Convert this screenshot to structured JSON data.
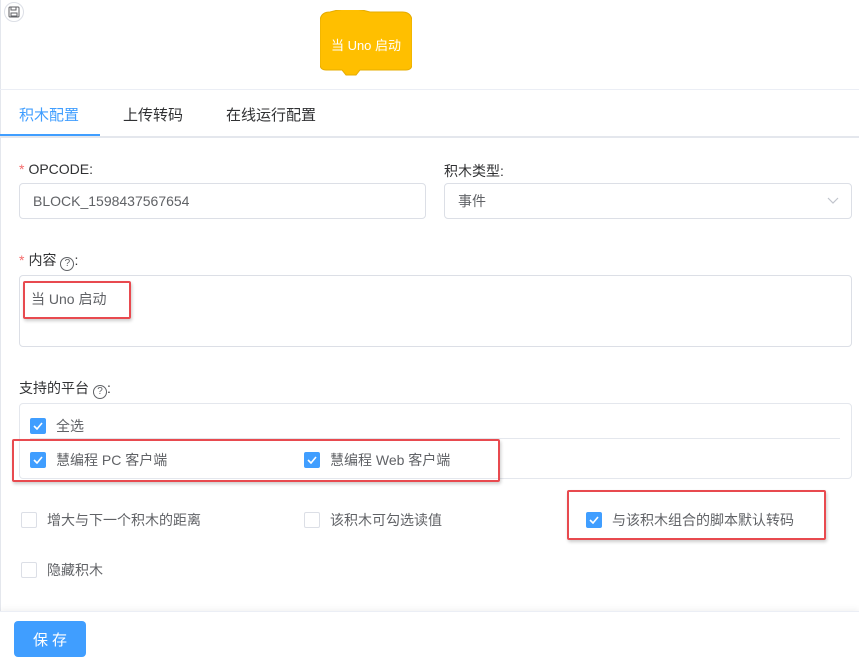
{
  "block": {
    "label": "当 Uno 启动",
    "color": "#FFBF00"
  },
  "tabs": [
    {
      "label": "积木配置",
      "active": true
    },
    {
      "label": "上传转码",
      "active": false
    },
    {
      "label": "在线运行配置",
      "active": false
    }
  ],
  "form": {
    "opcode": {
      "label": "OPCODE:",
      "required": true,
      "value": "BLOCK_1598437567654"
    },
    "block_type": {
      "label": "积木类型:",
      "value": "事件"
    },
    "content": {
      "label": "内容",
      "label_suffix": ":",
      "required": true,
      "value": "当 Uno 启动"
    },
    "platforms": {
      "label": "支持的平台",
      "label_suffix": ":",
      "select_all": {
        "label": "全选",
        "checked": true
      },
      "options": [
        {
          "label": "慧编程 PC 客户端",
          "checked": true
        },
        {
          "label": "慧编程 Web 客户端",
          "checked": true
        }
      ]
    },
    "options": [
      {
        "label": "增大与下一个积木的距离",
        "checked": false
      },
      {
        "label": "该积木可勾选读值",
        "checked": false
      },
      {
        "label": "与该积木组合的脚本默认转码",
        "checked": true
      },
      {
        "label": "隐藏积木",
        "checked": false
      }
    ]
  },
  "footer": {
    "save_label": "保存"
  },
  "colors": {
    "accent": "#409eff",
    "required": "#f56c6c",
    "highlight": "#e84a4f"
  }
}
